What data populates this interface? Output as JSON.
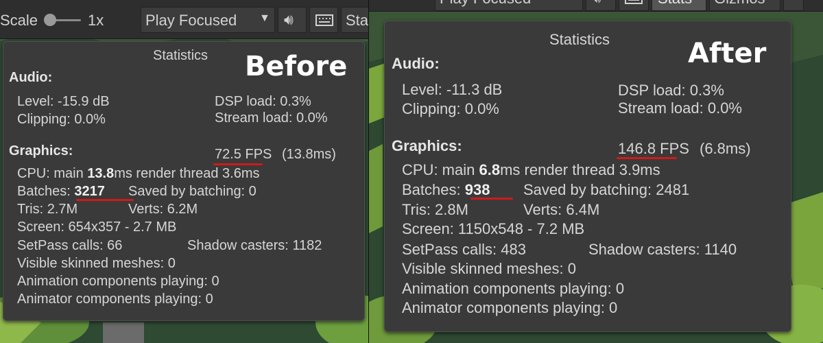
{
  "before": {
    "caption": "Before",
    "toolbar": {
      "scale_label": "Scale",
      "scale_value": "1x",
      "play_mode": "Play Focused",
      "stats_label": "Sta"
    },
    "stats": {
      "title": "Statistics",
      "audio_header": "Audio:",
      "level": "Level: -15.9 dB",
      "clipping": "Clipping: 0.0%",
      "dsp_load": "DSP load: 0.3%",
      "stream_load": "Stream load: 0.0%",
      "graphics_header": "Graphics:",
      "fps": "72.5 FPS",
      "fps_ms": "(13.8ms)",
      "cpu_prefix": "CPU: main ",
      "cpu_main": "13.8",
      "cpu_suffix": "ms  render thread 3.6ms",
      "batches_prefix": "Batches: ",
      "batches": "3217",
      "saved_by_batching": "Saved by batching: 0",
      "tris": "Tris: 2.7M",
      "verts": "Verts: 6.2M",
      "screen": "Screen: 654x357 - 2.7 MB",
      "setpass": "SetPass calls: 66",
      "shadow_casters": "Shadow casters: 1182",
      "skinned_meshes": "Visible skinned meshes: 0",
      "animation_components": "Animation components playing: 0",
      "animator_components": "Animator components playing: 0"
    }
  },
  "after": {
    "caption": "After",
    "toolbar": {
      "play_mode": "Play Focused",
      "stats_label": "Stats",
      "gizmos_label": "Gizmos"
    },
    "stats": {
      "title": "Statistics",
      "audio_header": "Audio:",
      "level": "Level: -11.3 dB",
      "clipping": "Clipping: 0.0%",
      "dsp_load": "DSP load: 0.3%",
      "stream_load": "Stream load: 0.0%",
      "graphics_header": "Graphics:",
      "fps": "146.8 FPS",
      "fps_ms": "(6.8ms)",
      "cpu_prefix": "CPU: main ",
      "cpu_main": "6.8",
      "cpu_suffix": "ms  render thread 3.9ms",
      "batches_prefix": "Batches: ",
      "batches": "938",
      "saved_by_batching": "Saved by batching: 2481",
      "tris": "Tris: 2.8M",
      "verts": "Verts: 6.4M",
      "screen": "Screen: 1150x548 - 7.2 MB",
      "setpass": "SetPass calls: 483",
      "shadow_casters": "Shadow casters: 1140",
      "skinned_meshes": "Visible skinned meshes: 0",
      "animation_components": "Animation components playing: 0",
      "animator_components": "Animator components playing: 0"
    }
  },
  "colors": {
    "highlight_underline": "#d11a1a",
    "panel_bg": "#3a3a3a",
    "toolbar_bg": "#2e2e2e"
  }
}
